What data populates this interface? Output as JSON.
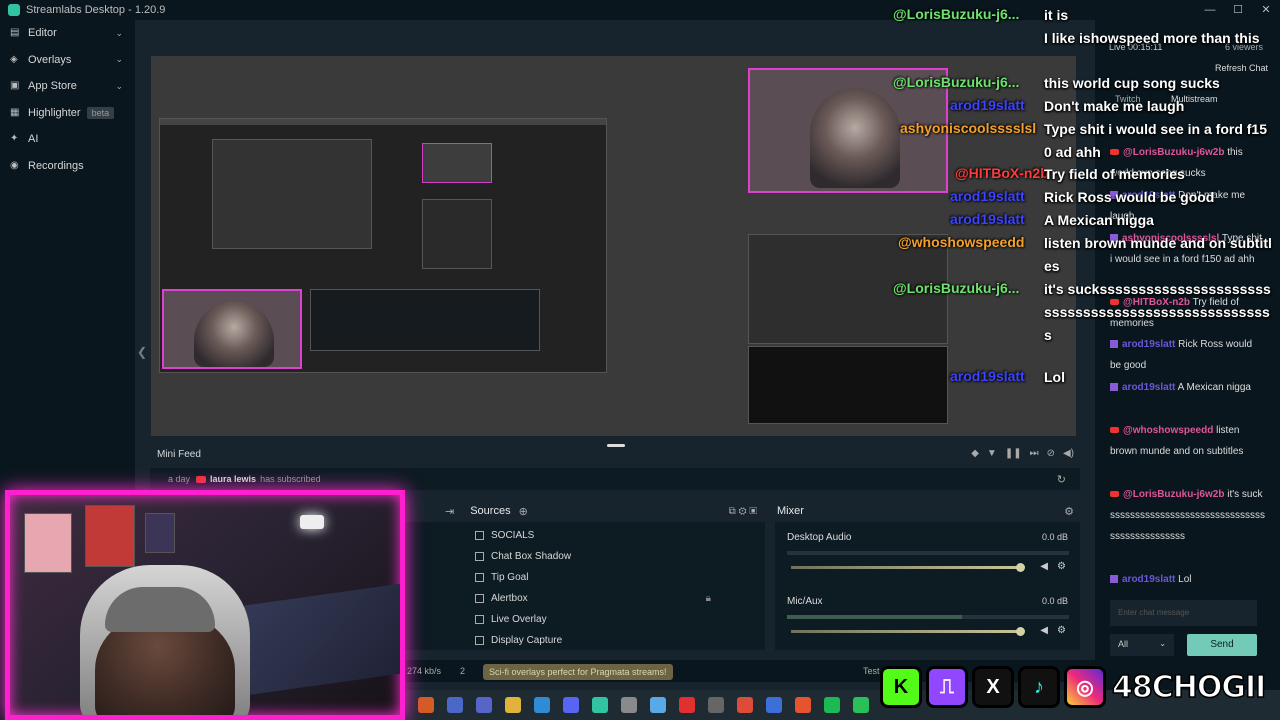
{
  "window": {
    "title": "Streamlabs Desktop - 1.20.9",
    "controls": [
      "—",
      "☐",
      "✕"
    ]
  },
  "sidebar": {
    "items": [
      {
        "label": "Editor",
        "icon": "editor-icon",
        "has_chevron": true
      },
      {
        "label": "Overlays",
        "icon": "overlays-icon",
        "has_chevron": true
      },
      {
        "label": "App Store",
        "icon": "store-icon",
        "has_chevron": true
      },
      {
        "label": "Highlighter",
        "icon": "highlighter-icon",
        "badge": "beta"
      },
      {
        "label": "AI",
        "icon": "ai-icon"
      },
      {
        "label": "Recordings",
        "icon": "recordings-icon"
      }
    ]
  },
  "minifeed": {
    "title": "Mini Feed",
    "event": {
      "time": "a day",
      "user": "laura lewis",
      "action": "has subscribed"
    }
  },
  "sources": {
    "title": "Sources",
    "items": [
      "SOCIALS",
      "Chat Box Shadow",
      "Tip Goal",
      "Alertbox",
      "Live Overlay",
      "Display Capture"
    ]
  },
  "mixer": {
    "title": "Mixer",
    "channels": [
      {
        "name": "Desktop Audio",
        "db": "0.0 dB",
        "volume": 1.0
      },
      {
        "name": "Mic/Aux",
        "db": "0.0 dB",
        "volume": 1.0
      }
    ]
  },
  "statusbar": {
    "bitrate": "274 kb/s",
    "count": "2",
    "promo": "Sci-fi overlays perfect for Pragmata streams!",
    "test": "Test"
  },
  "chat": {
    "live_time": "Live 00:15:11",
    "viewers": "6 viewers",
    "refresh": "Refresh Chat",
    "tabs": [
      "Twitch",
      "Multistream"
    ],
    "messages": [
      {
        "platform": "youtube",
        "user": "@LorisBuzuku-j6w2b",
        "text": "this world cup song sucks",
        "color": "#e0559a"
      },
      {
        "platform": "twitch",
        "user": "arod19slatt",
        "text": "Don't make me laugh",
        "color": "#6b57d8"
      },
      {
        "platform": "twitch",
        "user": "ashyoniscoolsssslsl",
        "text": "Type shit i would see in a ford f150 ad ahh",
        "color": "#e0559a"
      },
      {
        "platform": "youtube",
        "user": "@HITBoX-n2b",
        "text": "Try field of memories",
        "color": "#e0559a"
      },
      {
        "platform": "twitch",
        "user": "arod19slatt",
        "text": "Rick Ross would be good",
        "color": "#6b57d8"
      },
      {
        "platform": "twitch",
        "user": "arod19slatt",
        "text": "A Mexican nigga",
        "color": "#6b57d8"
      },
      {
        "platform": "youtube",
        "user": "@whoshowspeedd",
        "text": "listen brown munde and on subtitles",
        "color": "#e0559a"
      },
      {
        "platform": "youtube",
        "user": "@LorisBuzuku-j6w2b",
        "text": "it's suckssssssssssssssssssssssssssssssssssssssssssssss",
        "color": "#e0559a"
      },
      {
        "platform": "twitch",
        "user": "arod19slatt",
        "text": "Lol",
        "color": "#6b57d8"
      }
    ],
    "input_placeholder": "Enter chat message",
    "filter": "All",
    "send": "Send"
  },
  "overlay_chat": [
    {
      "user": "@LorisBuzuku-j6...",
      "color": "#6ee26e",
      "text": "it is"
    },
    {
      "user": "",
      "color": "#3b43ff",
      "text": "I like ishowspeed more than this"
    },
    {
      "user": "@LorisBuzuku-j6...",
      "color": "#6ee26e",
      "text": "this world cup song sucks"
    },
    {
      "user": "arod19slatt",
      "color": "#3b43ff",
      "text": "Don't make me laugh"
    },
    {
      "user": "ashyoniscoolsssslsl",
      "color": "#f4a12b",
      "text": "Type shit i would see in a ford f150 ad ahh"
    },
    {
      "user": "@HITBoX-n2b",
      "color": "#ff3b3b",
      "text": "Try field of memories"
    },
    {
      "user": "arod19slatt",
      "color": "#3b43ff",
      "text": "Rick Ross would be good"
    },
    {
      "user": "arod19slatt",
      "color": "#3b43ff",
      "text": "A Mexican nigga"
    },
    {
      "user": "@whoshowspeedd",
      "color": "#f4a12b",
      "text": "listen brown munde and on subtitles"
    },
    {
      "user": "@LorisBuzuku-j6...",
      "color": "#6ee26e",
      "text": "it's suckssssssssssssssssssssssssssssssssssssssssssssssssssss"
    },
    {
      "user": "arod19slatt",
      "color": "#3b43ff",
      "text": "Lol"
    }
  ],
  "socials": {
    "handle": "48CHOGII",
    "icons": [
      "kick-icon",
      "twitch-icon",
      "x-icon",
      "tiktok-icon",
      "instagram-icon"
    ],
    "glyphs": [
      "K",
      "⎍",
      "X",
      "♪",
      "◎"
    ]
  },
  "colors": {
    "accent": "#31c3a2",
    "border_pink": "#ff1fcf"
  }
}
